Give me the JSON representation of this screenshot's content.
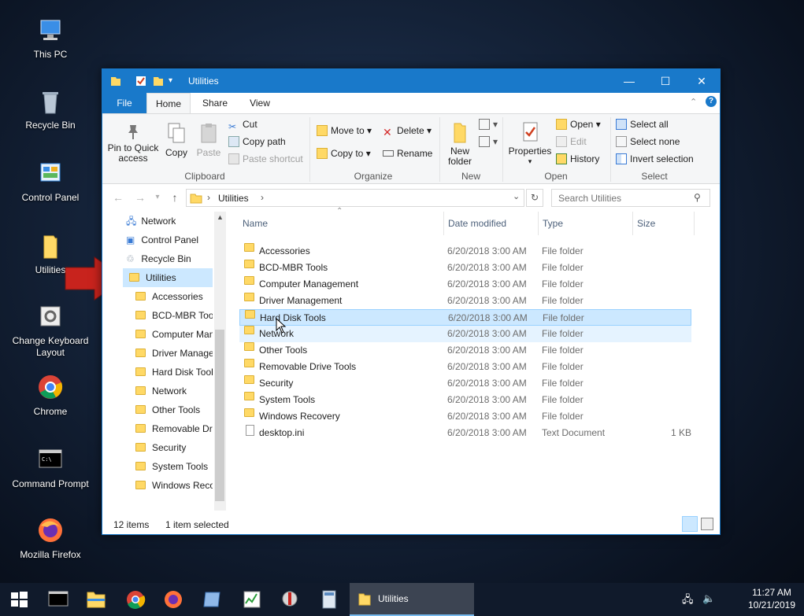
{
  "desktop": {
    "icons": [
      {
        "label": "This PC"
      },
      {
        "label": "Recycle Bin"
      },
      {
        "label": "Control Panel"
      },
      {
        "label": "Utilities"
      },
      {
        "label": "Change Keyboard Layout"
      },
      {
        "label": "Chrome"
      },
      {
        "label": "Command Prompt"
      },
      {
        "label": "Mozilla Firefox"
      }
    ]
  },
  "window": {
    "title": "Utilities",
    "controls": {
      "minimize": "—",
      "maximize": "☐",
      "close": "✕"
    }
  },
  "ribbon": {
    "tabs": [
      "File",
      "Home",
      "Share",
      "View"
    ],
    "clipboard": {
      "pin": "Pin to Quick access",
      "copy": "Copy",
      "paste": "Paste",
      "cut": "Cut",
      "copy_path": "Copy path",
      "paste_shortcut": "Paste shortcut",
      "label": "Clipboard"
    },
    "organize": {
      "move_to": "Move to",
      "copy_to": "Copy to",
      "delete": "Delete",
      "rename": "Rename",
      "label": "Organize"
    },
    "new": {
      "new_folder": "New folder",
      "label": "New"
    },
    "open": {
      "properties": "Properties",
      "open": "Open",
      "edit": "Edit",
      "history": "History",
      "label": "Open"
    },
    "select": {
      "select_all": "Select all",
      "select_none": "Select none",
      "invert": "Invert selection",
      "label": "Select"
    }
  },
  "address": {
    "path": "Utilities",
    "search_placeholder": "Search Utilities"
  },
  "nav_pane": {
    "items": [
      "Network",
      "Control Panel",
      "Recycle Bin",
      "Utilities"
    ],
    "children": [
      "Accessories",
      "BCD-MBR Tools",
      "Computer Management",
      "Driver Management",
      "Hard Disk Tools",
      "Network",
      "Other Tools",
      "Removable Drive Tools",
      "Security",
      "System Tools",
      "Windows Recovery"
    ]
  },
  "columns": {
    "name": "Name",
    "date": "Date modified",
    "type": "Type",
    "size": "Size"
  },
  "files": [
    {
      "name": "Accessories",
      "date": "6/20/2018 3:00 AM",
      "type": "File folder",
      "size": ""
    },
    {
      "name": "BCD-MBR Tools",
      "date": "6/20/2018 3:00 AM",
      "type": "File folder",
      "size": ""
    },
    {
      "name": "Computer Management",
      "date": "6/20/2018 3:00 AM",
      "type": "File folder",
      "size": ""
    },
    {
      "name": "Driver Management",
      "date": "6/20/2018 3:00 AM",
      "type": "File folder",
      "size": ""
    },
    {
      "name": "Hard Disk Tools",
      "date": "6/20/2018 3:00 AM",
      "type": "File folder",
      "size": ""
    },
    {
      "name": "Network",
      "date": "6/20/2018 3:00 AM",
      "type": "File folder",
      "size": ""
    },
    {
      "name": "Other Tools",
      "date": "6/20/2018 3:00 AM",
      "type": "File folder",
      "size": ""
    },
    {
      "name": "Removable Drive Tools",
      "date": "6/20/2018 3:00 AM",
      "type": "File folder",
      "size": ""
    },
    {
      "name": "Security",
      "date": "6/20/2018 3:00 AM",
      "type": "File folder",
      "size": ""
    },
    {
      "name": "System Tools",
      "date": "6/20/2018 3:00 AM",
      "type": "File folder",
      "size": ""
    },
    {
      "name": "Windows Recovery",
      "date": "6/20/2018 3:00 AM",
      "type": "File folder",
      "size": ""
    },
    {
      "name": "desktop.ini",
      "date": "6/20/2018 3:00 AM",
      "type": "Text Document",
      "size": "1 KB"
    }
  ],
  "status": {
    "count": "12 items",
    "selected": "1 item selected"
  },
  "taskbar": {
    "active_label": "Utilities",
    "time": "11:27 AM",
    "date": "10/21/2019"
  },
  "colors": {
    "accent": "#1979ca",
    "selection": "#cce8ff",
    "arrow": "#c8231d"
  }
}
